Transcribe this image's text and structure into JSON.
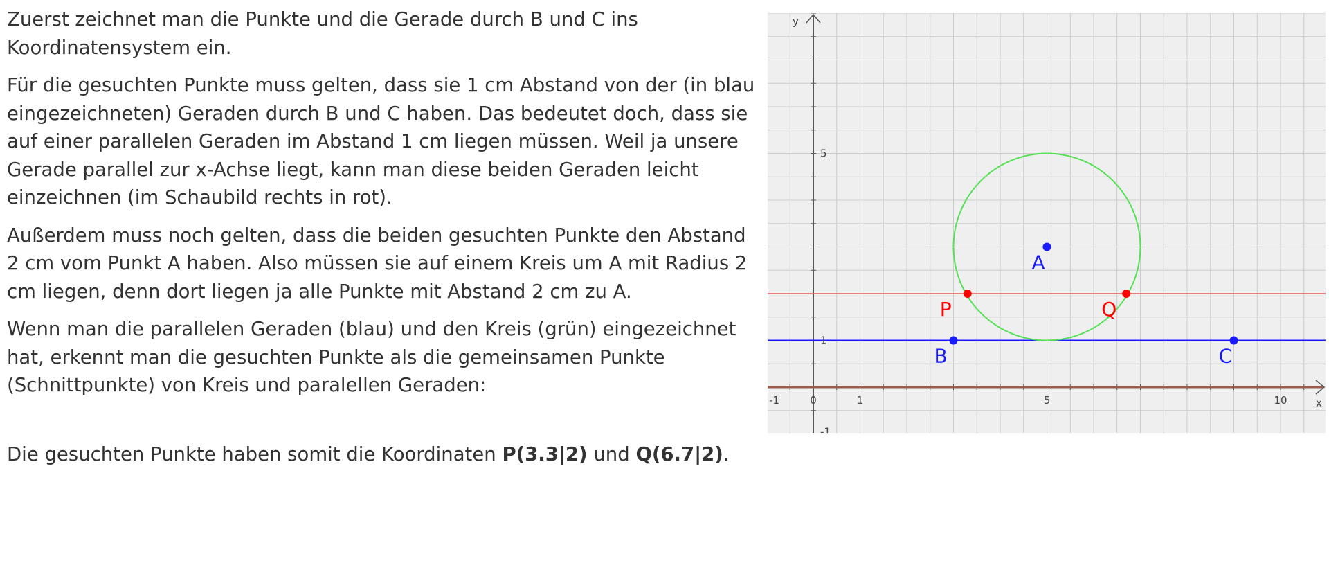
{
  "text": {
    "p1": "Zuerst zeichnet man die Punkte und die Gerade durch B und C ins Koordinatensystem ein.",
    "p2": "Für die gesuchten Punkte muss gelten, dass sie 1 cm Abstand von der (in blau eingezeichneten) Geraden durch B und C haben. Das bedeutet doch, dass sie auf einer parallelen Geraden im Abstand 1 cm liegen müssen. Weil ja unsere Gerade parallel zur x-Achse liegt, kann man diese beiden Geraden leicht einzeichnen (im Schaubild rechts in rot).",
    "p3": "Außerdem muss noch gelten, dass die beiden gesuchten Punkte den Abstand 2 cm vom Punkt A haben. Also müssen sie auf einem Kreis um A mit Radius 2 cm liegen, denn dort liegen ja alle Punkte mit Abstand 2 cm zu A.",
    "p4": "Wenn man die parallelen Geraden (blau) und den Kreis (grün) eingezeichnet hat, erkennt man die gesuchten Punkte als die gemeinsamen Punkte (Schnittpunkte) von Kreis und paralellen Geraden:",
    "conclusion_prefix": "Die gesuchten Punkte haben somit die Koordinaten ",
    "p_coord": "P(3.3|2)",
    "conclusion_mid": " und ",
    "q_coord": "Q(6.7|2)",
    "conclusion_suffix": "."
  },
  "figure": {
    "x_axis_label": "x",
    "y_axis_label": "y",
    "x_tick_labels": [
      "-1",
      "0",
      "1",
      "5",
      "10"
    ],
    "y_tick_labels": [
      "5",
      "1",
      "-1"
    ],
    "x_range": [
      -1,
      11
    ],
    "y_range": [
      -1,
      8
    ],
    "grid": true,
    "colors": {
      "grid": "#cccccc",
      "background": "#efefef",
      "axis": "#555555",
      "x_axis_line": "#9b5a4a",
      "blue": "#1a1aff",
      "red": "#e85a5a",
      "green": "#55e055",
      "point_red": "#ff0000"
    },
    "points": [
      {
        "name": "A",
        "x": 5,
        "y": 3,
        "color": "blue"
      },
      {
        "name": "B",
        "x": 3,
        "y": 1,
        "color": "blue"
      },
      {
        "name": "C",
        "x": 9,
        "y": 1,
        "color": "blue"
      },
      {
        "name": "P",
        "x": 3.3,
        "y": 2,
        "color": "red"
      },
      {
        "name": "Q",
        "x": 6.7,
        "y": 2,
        "color": "red"
      }
    ],
    "lines": [
      {
        "name": "line-bc",
        "y": 1,
        "color": "blue"
      },
      {
        "name": "parallel-line",
        "y": 2,
        "color": "red"
      }
    ],
    "circle": {
      "center_x": 5,
      "center_y": 3,
      "radius": 2,
      "color": "green"
    }
  }
}
